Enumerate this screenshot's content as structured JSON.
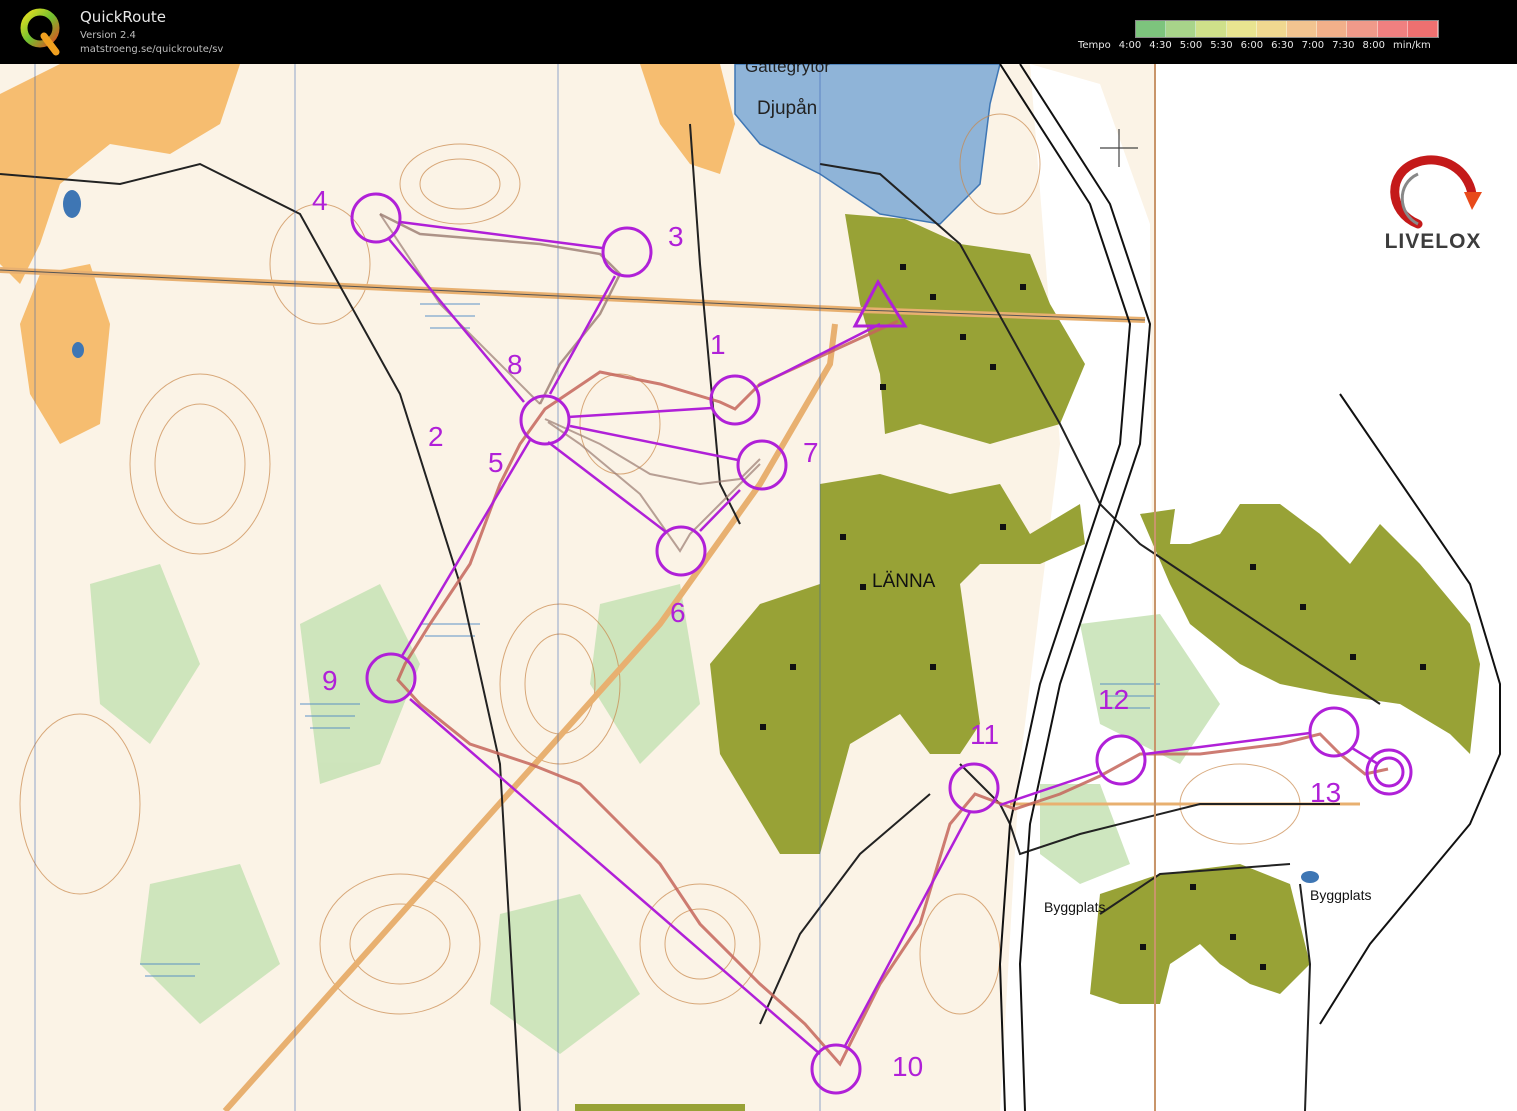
{
  "app": {
    "title": "QuickRoute",
    "version": "Version 2.4",
    "url": "matstroeng.se/quickroute/sv"
  },
  "pace_legend": {
    "label": "Tempo",
    "ticks": [
      "4:00",
      "4:30",
      "5:00",
      "5:30",
      "6:00",
      "6:30",
      "7:00",
      "7:30",
      "8:00"
    ],
    "unit": "min/km",
    "gradient_colors": [
      "#7dc47d",
      "#a8d48a",
      "#cfe08a",
      "#e8e490",
      "#f0d890",
      "#f2c490",
      "#f2b08a",
      "#f09a8a",
      "#f08080",
      "#ee7070"
    ]
  },
  "branding": {
    "livelox": "LIVELOX",
    "logo_icon": "livelox-swirl-icon",
    "app_icon": "quickroute-q-icon"
  },
  "map": {
    "place_names": [
      "Djupån",
      "LÄNNA",
      "Byggplats",
      "Byggplats"
    ],
    "partial_label": "Gättegrytor",
    "control_numbers": [
      "1",
      "2",
      "3",
      "4",
      "5",
      "6",
      "7",
      "8",
      "9",
      "10",
      "11",
      "12",
      "13"
    ],
    "course_color": "#b020d8",
    "route_color": "#c4655a"
  }
}
